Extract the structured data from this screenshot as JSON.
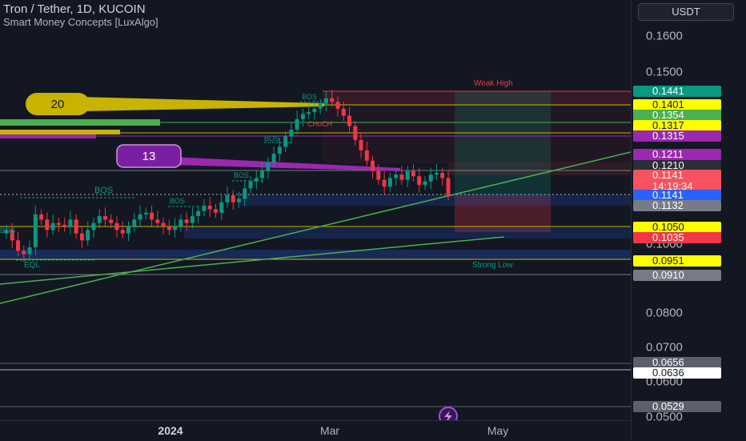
{
  "header": {
    "symbol_title": "Tron / Tether, 1D, KUCOIN",
    "indicator_title": "Smart Money Concepts [LuxAlgo]"
  },
  "price_scale": {
    "currency_button": "USDT",
    "ticks": [
      {
        "label": "0.1600",
        "value": 0.16
      },
      {
        "label": "0.1500",
        "value": 0.15
      },
      {
        "label": "0.1000",
        "value": 0.1
      },
      {
        "label": "0.0800",
        "value": 0.08
      },
      {
        "label": "0.0700",
        "value": 0.07
      },
      {
        "label": "0.0600",
        "value": 0.06
      },
      {
        "label": "0.0500",
        "value": 0.05
      }
    ],
    "tags": [
      {
        "label": "0.1441",
        "bg": "#089981",
        "fg": "#ffffff"
      },
      {
        "label": "0.1401",
        "bg": "#ffff00",
        "fg": "#131722"
      },
      {
        "label": "0.1354",
        "bg": "#4caf50",
        "fg": "#ffffff"
      },
      {
        "label": "0.1317",
        "bg": "#ffff00",
        "fg": "#131722"
      },
      {
        "label": "0.1315",
        "bg": "#9c27b0",
        "fg": "#ffffff"
      },
      {
        "label": "0.1211",
        "bg": "#9c27b0",
        "fg": "#ffffff"
      },
      {
        "label": "0.1210",
        "bg": "#2a2e39",
        "fg": "#ffffff"
      },
      {
        "label": "0.1141",
        "sub": "14:19:34",
        "bg": "#f7525f",
        "fg": "#ffffff"
      },
      {
        "label": "0.1141",
        "bg": "#2962ff",
        "fg": "#ffffff"
      },
      {
        "label": "0.1132",
        "bg": "#787b86",
        "fg": "#ffffff"
      },
      {
        "label": "0.1050",
        "bg": "#ffff00",
        "fg": "#131722"
      },
      {
        "label": "0.1035",
        "bg": "#f23645",
        "fg": "#ffffff"
      },
      {
        "label": "0.0951",
        "bg": "#ffff00",
        "fg": "#131722"
      },
      {
        "label": "0.0910",
        "bg": "#787b86",
        "fg": "#ffffff"
      },
      {
        "label": "0.0656",
        "bg": "#5d606b",
        "fg": "#ffffff"
      },
      {
        "label": "0.0636",
        "bg": "#ffffff",
        "fg": "#131722"
      },
      {
        "label": "0.0529",
        "bg": "#5d606b",
        "fg": "#ffffff"
      }
    ]
  },
  "time_axis": {
    "labels": [
      {
        "label": "2024",
        "bold": true
      },
      {
        "label": "Mar",
        "bold": false
      },
      {
        "label": "May",
        "bold": false
      }
    ]
  },
  "annotations": {
    "bubble_gold": "20",
    "bubble_purple": "13",
    "weak_high": "Weak High",
    "strong_low": "Strong Low",
    "eql": "EQL",
    "choch": "CHoCH",
    "bos_labels": [
      "BOS",
      "BOS",
      "BOS",
      "BOS",
      "BOS",
      "BOS"
    ]
  },
  "colors": {
    "background": "#131722",
    "candle_up": "#089981",
    "candle_down": "#f23645",
    "trendline": "#4caf50",
    "gold_line": "#c8b400",
    "purple_line": "#9c27b0"
  },
  "chart_data": {
    "type": "candlestick",
    "symbol": "TRX/USDT",
    "timeframe": "1D",
    "exchange": "KUCOIN",
    "ylim": [
      0.05,
      0.16
    ],
    "x_labels": [
      "2024",
      "Mar",
      "May"
    ],
    "last_price": 0.1141,
    "bar_countdown": "14:19:34",
    "levels": [
      0.1441,
      0.1401,
      0.1354,
      0.1317,
      0.1315,
      0.1211,
      0.121,
      0.1141,
      0.1132,
      0.105,
      0.1035,
      0.0951,
      0.091,
      0.0656,
      0.0636,
      0.0529
    ],
    "closes": [
      0.104,
      0.101,
      0.098,
      0.097,
      0.099,
      0.1085,
      0.107,
      0.104,
      0.106,
      0.1055,
      0.105,
      0.107,
      0.103,
      0.101,
      0.104,
      0.106,
      0.108,
      0.107,
      0.106,
      0.104,
      0.103,
      0.105,
      0.107,
      0.1085,
      0.109,
      0.107,
      0.106,
      0.105,
      0.104,
      0.105,
      0.107,
      0.106,
      0.108,
      0.1095,
      0.111,
      0.11,
      0.109,
      0.112,
      0.114,
      0.112,
      0.113,
      0.116,
      0.118,
      0.119,
      0.121,
      0.1235,
      0.126,
      0.128,
      0.131,
      0.133,
      0.136,
      0.1375,
      0.138,
      0.139,
      0.1405,
      0.142,
      0.141,
      0.139,
      0.137,
      0.134,
      0.13,
      0.127,
      0.124,
      0.121,
      0.1185,
      0.1165,
      0.119,
      0.12,
      0.1185,
      0.121,
      0.1195,
      0.117,
      0.118,
      0.12,
      0.1205,
      0.119,
      0.1141
    ]
  }
}
